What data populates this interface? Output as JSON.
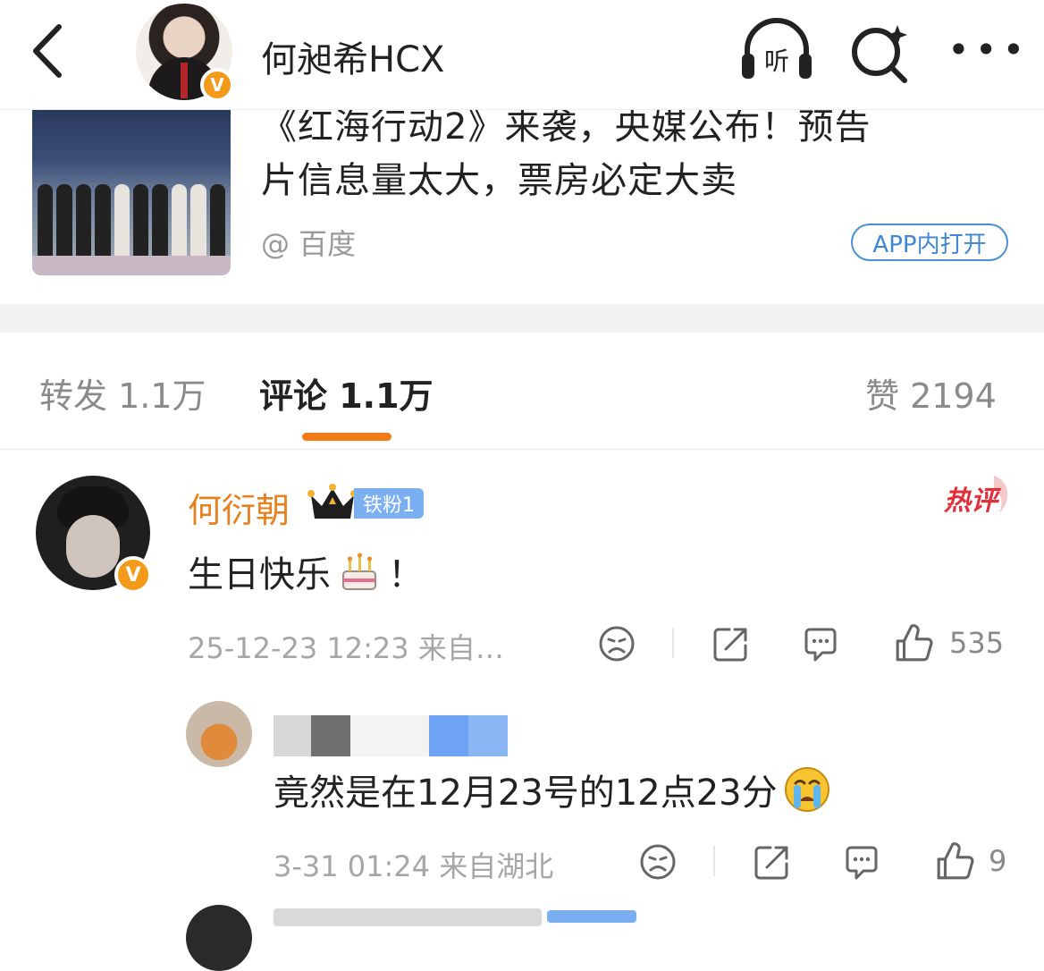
{
  "header": {
    "title": "何昶希HCX",
    "verified_badge": "V",
    "listen_label": "听"
  },
  "card": {
    "title_line1": "《红海行动2》来袭，央媒公布！预告",
    "title_line2": "片信息量太大，票房必定大卖",
    "source": "@ 百度",
    "open_in_app": "APP内打开"
  },
  "tabs": {
    "forward": "转发 1.1万",
    "comment": "评论 1.1万",
    "like": "赞 2194",
    "accent_color": "#f07b17"
  },
  "comments": [
    {
      "author": "何衍朝",
      "verified_badge": "V",
      "fan_badge": "铁粉1",
      "hot_badge": "热评",
      "text": "生日快乐",
      "text_suffix": "！",
      "emoji": "cake-icon",
      "meta": "25-12-23 12:23 来自…",
      "likes": "535"
    },
    {
      "author_redacted": true,
      "text": "竟然是在12月23号的12点23分",
      "emoji": "crying-face-icon",
      "meta": "3-31 01:24 来自湖北",
      "likes": "9"
    }
  ]
}
